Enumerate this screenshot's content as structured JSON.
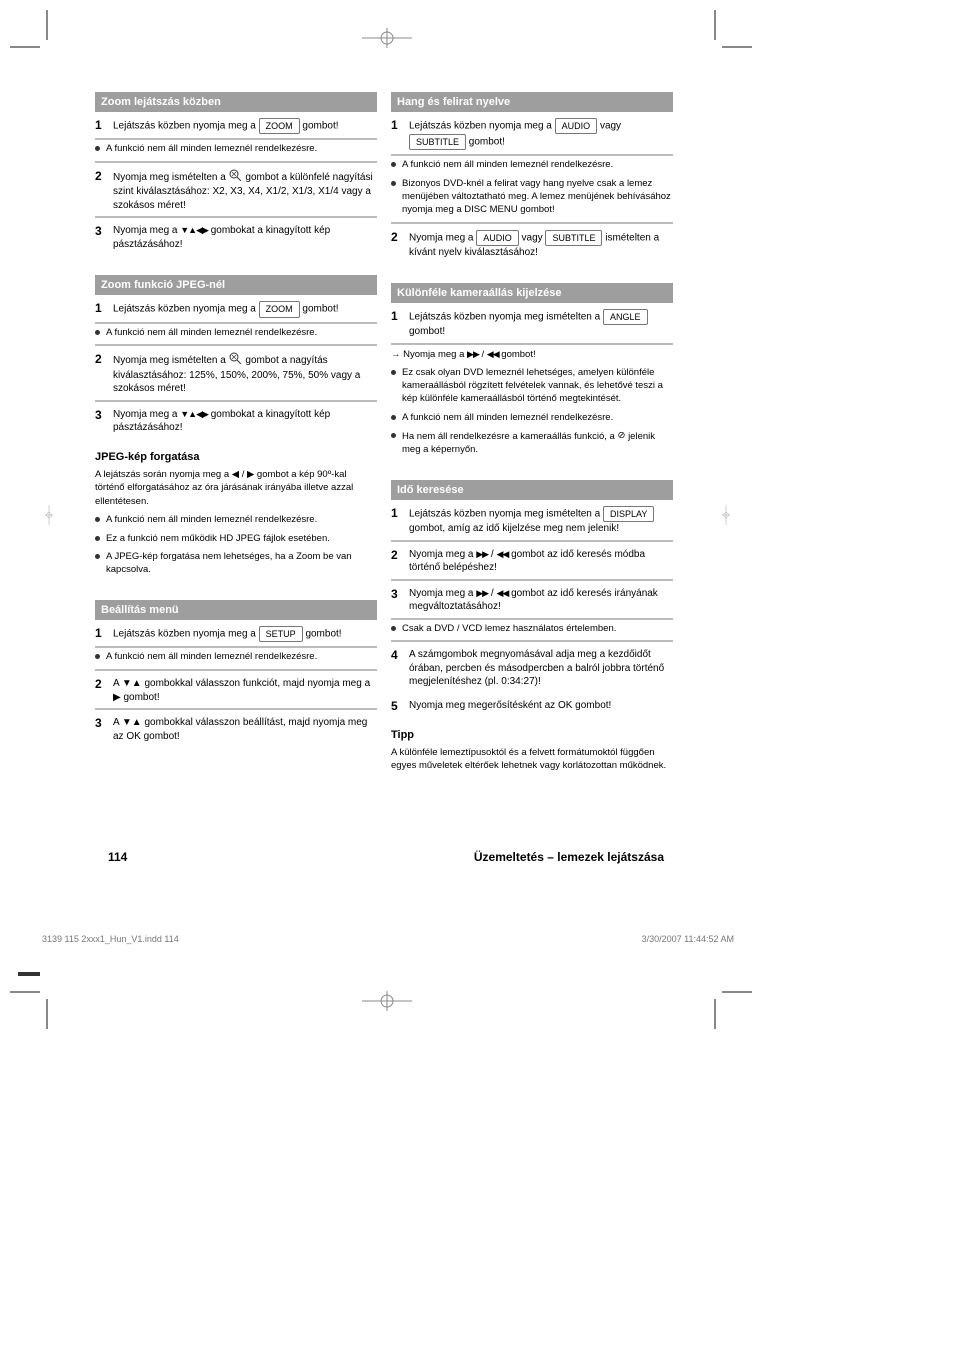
{
  "buttons": {
    "zoom": "ZOOM",
    "setup": "SETUP",
    "display": "DISPLAY",
    "angle": "ANGLE"
  },
  "arrows": "▼▲◀▶",
  "ff": "▶▶",
  "rw": "◀◀",
  "sectionA": {
    "title": "Zoom lejátszás közben",
    "step1_pre": "Lejátszás közben nyomja meg a",
    "step1_post": "gombot!",
    "step2a": "Nyomja meg ismételten a",
    "step2b": "gombot a különfelé nagyítási szint kiválasztásához: X2, X3, X4, X1/2, X1/3, X1/4 vagy a szokásos méret!",
    "step3a": "Nyomja meg a",
    "step3b": "gombokat a kinagyított kép pásztázásához!",
    "bullet1": "A funkció nem áll minden lemeznél rendelkezésre."
  },
  "sectionB": {
    "title": "Zoom funkció JPEG-nél",
    "step1_pre": "Lejátszás közben nyomja meg a",
    "step1_post": "gombot!",
    "step2a": "Nyomja meg ismételten a",
    "step2b": "gombot a nagyítás kiválasztásához: 125%, 150%, 200%, 75%, 50% vagy a szokásos méret!",
    "step3a": "Nyomja meg a",
    "step3b": "gombokat a kinagyított kép pásztázásához!",
    "bullet1": "A funkció nem áll minden lemeznél rendelkezésre.",
    "sub": "JPEG-kép forgatása",
    "subBody": "A lejátszás során nyomja meg a ◀ / ▶ gombot a kép 90º-kal történő elforgatásához az óra járásának irányába illetve azzal ellentétesen.",
    "bullet2": "A funkció nem áll minden lemeznél rendelkezésre.",
    "bullet3": "Ez a funkció nem működik HD JPEG fájlok esetében.",
    "bullet4": "A JPEG-kép forgatása nem lehetséges, ha a Zoom be van kapcsolva."
  },
  "sectionC": {
    "title": "Beállítás menü",
    "step1_pre": "Lejátszás közben nyomja meg a",
    "step1_post": "gombot!",
    "step2": "A ▼▲ gombokkal válasszon funkciót, majd nyomja meg a ▶ gombot!",
    "step3": "A ▼▲ gombokkal válasszon beállítást, majd nyomja meg az OK gombot!",
    "bullet1": "A funkció nem áll minden lemeznél rendelkezésre."
  },
  "sectionD": {
    "title": "Hang és felirat nyelve",
    "step1_pre": "Lejátszás közben nyomja meg a",
    "step1_mid": "vagy",
    "step1_post": "gombot!",
    "step2_pre": "Nyomja meg a",
    "step2_mid": "vagy",
    "step2_post": "ismételten a kívánt nyelv kiválasztásához!",
    "bullet1": "A funkció nem áll minden lemeznél rendelkezésre.",
    "bullet2": "Bizonyos DVD-knél a felirat vagy hang nyelve csak a lemez menüjében változtatható meg. A lemez menüjének behívásához nyomja meg a DISC MENU gombot!"
  },
  "sectionE": {
    "title": "Különféle kameraállás kijelzése",
    "step1_pre": "Lejátszás közben nyomja meg ismételten a",
    "step1_post": "gombot!",
    "bullet1": "Ez csak olyan DVD lemeznél lehetséges, amelyen különféle kameraállásból rögzített felvételek vannak, és lehetővé teszi a kép különféle kameraállásból történő megtekintését.",
    "bullet2": "A funkció nem áll minden lemeznél rendelkezésre.",
    "bullet3a": "Ha nem áll rendelkezésre a kameraállás funkció, a",
    "bullet3b": "jelenik meg a képernyőn."
  },
  "sectionF": {
    "title": "Idő keresése",
    "step1_pre": "Lejátszás közben nyomja meg ismételten a",
    "step1_post": "gombot, amíg az idő kijelzése meg nem jelenik!",
    "step2_pre": "Nyomja meg a",
    "step2_post": "gombot az idő keresés módba történő belépéshez!",
    "step3_pre": "Nyomja meg a",
    "step3_post": "gombot az idő keresés irányának megváltoztatásához!",
    "step4": "A számgombok megnyomásával adja meg a kezdőidőt órában, percben és másodpercben a balról jobbra történő megjelenítéshez (pl. 0:34:27)!",
    "step5": "Nyomja meg megerősítésként az OK gombot!",
    "sub": "Tipp",
    "subBody": "A különféle lemeztípusoktól és a felvett formátumoktól függően egyes műveletek eltérőek lehetnek vagy korlátozottan működnek.",
    "bullet1": "Csak a DVD / VCD lemez használatos értelemben."
  },
  "footer": {
    "pageNumber": "114",
    "description": "Üzemeltetés – lemezek lejátszása"
  },
  "fileFooter": "3139 115 2xxx1_Hun_V1.indd   114",
  "fileTimestamp": "3/30/2007   11:44:52 AM"
}
